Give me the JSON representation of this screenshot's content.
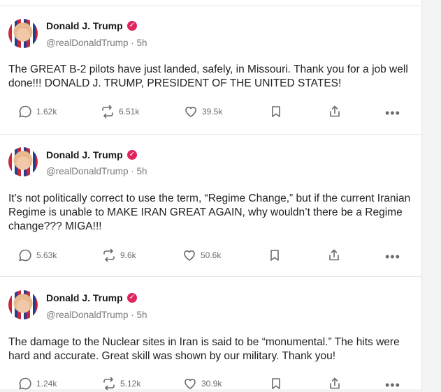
{
  "posts": [
    {
      "author": "Donald J. Trump",
      "verified_icon": "verified-badge-icon",
      "handle": "@realDonaldTrump · 5h",
      "text": "The GREAT B-2 pilots have just landed, safely, in Missouri. Thank you for a job well done!!! DONALD J. TRUMP, PRESIDENT OF THE UNITED STATES!",
      "replies": "1.62k",
      "retruths": "6.51k",
      "likes": "39.5k"
    },
    {
      "author": "Donald J. Trump",
      "verified_icon": "verified-badge-icon",
      "handle": "@realDonaldTrump · 5h",
      "text": "It’s not politically correct to use the term, “Regime Change,” but if the current Iranian Regime is unable to MAKE IRAN GREAT AGAIN, why wouldn’t there be a Regime change??? MIGA!!!",
      "replies": "5.63k",
      "retruths": "9.6k",
      "likes": "50.6k"
    },
    {
      "author": "Donald J. Trump",
      "verified_icon": "verified-badge-icon",
      "handle": "@realDonaldTrump · 5h",
      "text": "The damage to the Nuclear sites in Iran is said to be “monumental.” The hits were hard and accurate. Great skill was shown by our military. Thank you!",
      "replies": "1.24k",
      "retruths": "5.12k",
      "likes": "30.9k"
    }
  ],
  "colors": {
    "verified_badge": "#e0245e",
    "icon": "#6b6b6b",
    "handle": "#7a7a7a",
    "divider": "#e6e6e6"
  }
}
